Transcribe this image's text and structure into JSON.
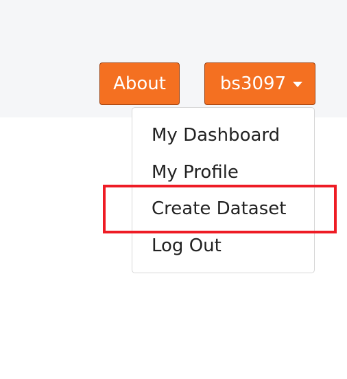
{
  "navbar": {
    "about_label": "About",
    "user_label": "bs3097"
  },
  "dropdown": {
    "items": [
      {
        "label": "My Dashboard"
      },
      {
        "label": "My Profile"
      },
      {
        "label": "Create Dataset"
      },
      {
        "label": "Log Out"
      }
    ]
  },
  "colors": {
    "button_bg": "#f47021",
    "highlight": "#ee1c25",
    "navbar_bg": "#f5f6f8"
  },
  "icons": {
    "user_dropdown": "caret-down-icon"
  }
}
